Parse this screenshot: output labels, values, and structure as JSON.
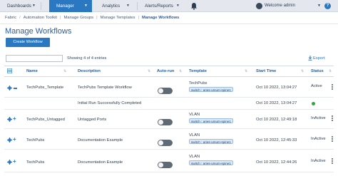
{
  "nav": {
    "items": [
      {
        "label": "Dashboards"
      },
      {
        "label": "Manager"
      },
      {
        "label": "Analytics"
      },
      {
        "label": "Alerts/Reports"
      }
    ],
    "welcome": "Welcome admin"
  },
  "breadcrumb": [
    "Fabric",
    "Automation Toolkit",
    "Manage Groups",
    "Manage Templates",
    "Manage Workflows"
  ],
  "page": {
    "title": "Manage Workflows",
    "create_button": "Create Workflow",
    "entries_text": "Showing 4 of 4 entries",
    "export_label": "Export",
    "search_placeholder": ""
  },
  "table": {
    "headers": [
      "Name",
      "Description",
      "Auto-run",
      "Template",
      "Start Time",
      "Status"
    ],
    "rows": [
      {
        "name": "TechPubs_Template",
        "description": "TechPubs Template Workflow",
        "template": "TechPubs",
        "tag": "switch : aries-umum-spine1",
        "start_time": "Oct 10 2022, 13:04:27",
        "status": "Active"
      },
      {
        "name": "",
        "description": "Initial Run Successfully Completed",
        "template": "",
        "tag": "",
        "start_time": "Oct 10 2022, 13:04:27",
        "status": ""
      },
      {
        "name": "TechPubs_Untagged",
        "description": "Untagged Ports",
        "template": "VLAN",
        "tag": "switch : aries-umum-spine1",
        "start_time": "Oct 10 2022, 12:49:18",
        "status": "InActive"
      },
      {
        "name": "TechPubs",
        "description": "Documentation Example",
        "template": "VLAN",
        "tag": "switch : aries-umum-spine1",
        "start_time": "Oct 10 2022, 12:45:33",
        "status": "InActive"
      },
      {
        "name": "TechPubs",
        "description": "Documentation Example",
        "template": "VLAN",
        "tag": "switch : aries-umum-spine1",
        "start_time": "Oct 10 2022, 12:44:26",
        "status": "InActive"
      }
    ]
  },
  "colors": {
    "accent": "#2b78c2",
    "toggle_off": "#5e6a76",
    "success": "#2eaa3a"
  }
}
